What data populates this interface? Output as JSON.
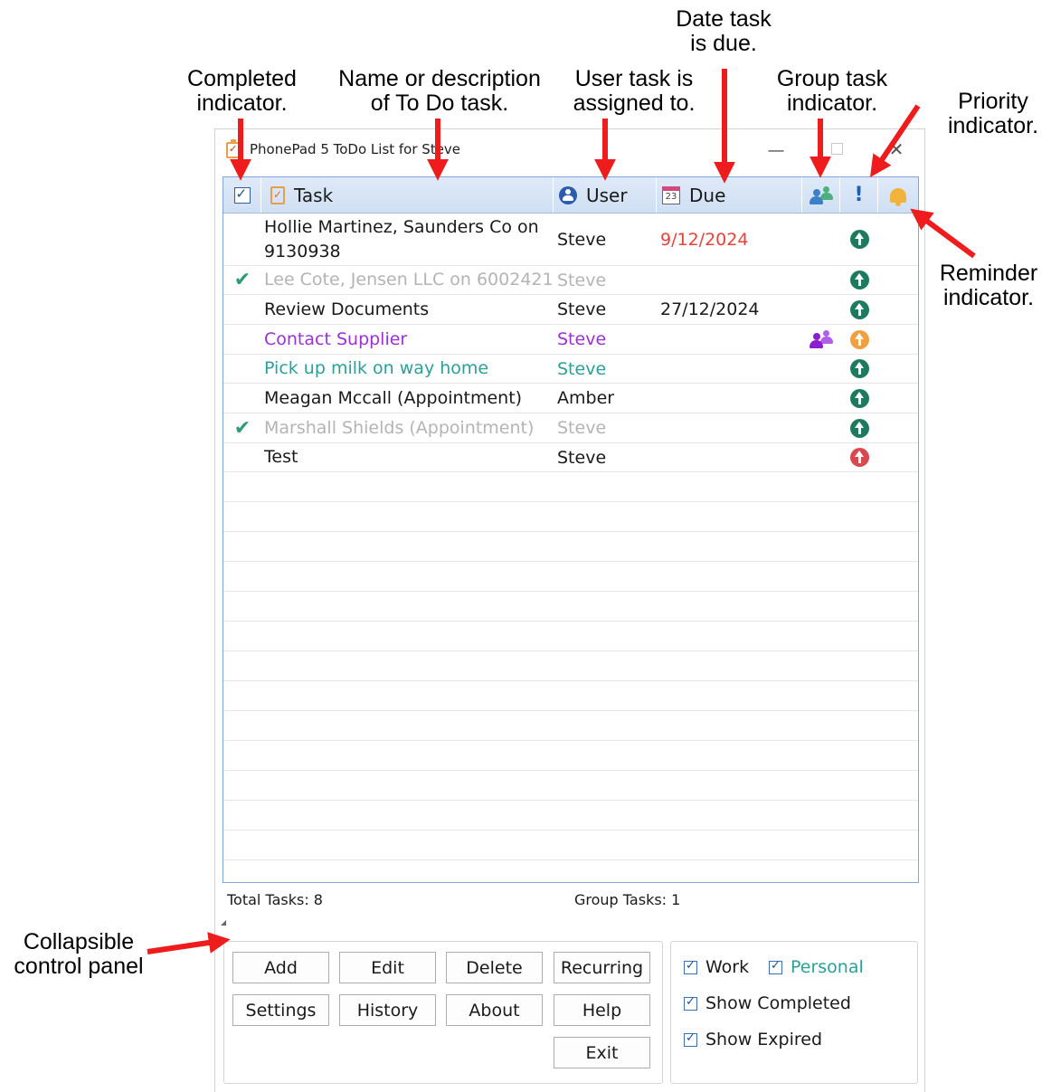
{
  "annotations": {
    "completed": [
      "Completed",
      "indicator."
    ],
    "task_name": [
      "Name or description",
      "of To Do task."
    ],
    "user": [
      "User task is",
      "assigned to."
    ],
    "due": [
      "Date task",
      "is due."
    ],
    "group": [
      "Group task",
      "indicator."
    ],
    "priority": [
      "Priority",
      "indicator."
    ],
    "reminder": [
      "Reminder",
      "indicator."
    ],
    "collapsible": [
      "Collapsible",
      "control panel"
    ]
  },
  "window": {
    "title": "PhonePad 5 ToDo List for Steve",
    "minimize_glyph": "—",
    "close_glyph": "✕"
  },
  "columns": {
    "task": "Task",
    "user": "User",
    "due": "Due",
    "due_icon_day": "23",
    "priority_glyph": "!"
  },
  "colors": {
    "normal": "#1a1a1a",
    "completed": "#b4b4b4",
    "overdue": "#e8413b",
    "work_purple": "#9b30d8",
    "personal_teal": "#2aa198",
    "priority_normal": "#1e7a5e",
    "priority_medium": "#f0a040",
    "priority_high": "#d9484e",
    "group_header_icon": "#3f7ec9",
    "arrow_red": "#ee1c1c"
  },
  "tasks": [
    {
      "done": false,
      "task": "Hollie Martinez, Saunders Co on 9130938",
      "user": "Steve",
      "due": "9/12/2024",
      "group": false,
      "priority": "normal",
      "style": "normal",
      "due_style": "overdue"
    },
    {
      "done": true,
      "task": "Lee Cote, Jensen LLC on 6002421",
      "user": "Steve",
      "due": "",
      "group": false,
      "priority": "normal",
      "style": "completed",
      "due_style": "normal"
    },
    {
      "done": false,
      "task": "Review Documents",
      "user": "Steve",
      "due": "27/12/2024",
      "group": false,
      "priority": "normal",
      "style": "normal",
      "due_style": "normal"
    },
    {
      "done": false,
      "task": "Contact Supplier",
      "user": "Steve",
      "due": "",
      "group": true,
      "priority": "medium",
      "style": "work",
      "due_style": "normal"
    },
    {
      "done": false,
      "task": "Pick up milk on way home",
      "user": "Steve",
      "due": "",
      "group": false,
      "priority": "normal",
      "style": "personal",
      "due_style": "normal"
    },
    {
      "done": false,
      "task": "Meagan Mccall (Appointment)",
      "user": "Amber",
      "due": "",
      "group": false,
      "priority": "normal",
      "style": "normal",
      "due_style": "normal"
    },
    {
      "done": true,
      "task": "Marshall Shields (Appointment)",
      "user": "Steve",
      "due": "",
      "group": false,
      "priority": "normal",
      "style": "completed",
      "due_style": "normal"
    },
    {
      "done": false,
      "task": "Test",
      "user": "Steve",
      "due": "",
      "group": false,
      "priority": "high",
      "style": "normal",
      "due_style": "normal"
    }
  ],
  "status": {
    "total": "Total Tasks: 8",
    "group": "Group Tasks: 1"
  },
  "buttons": {
    "add": "Add",
    "edit": "Edit",
    "delete": "Delete",
    "recurring": "Recurring",
    "settings": "Settings",
    "history": "History",
    "about": "About",
    "help": "Help",
    "exit": "Exit"
  },
  "options": {
    "work": {
      "label": "Work",
      "checked": true
    },
    "personal": {
      "label": "Personal",
      "checked": true
    },
    "show_completed": {
      "label": "Show Completed",
      "checked": true
    },
    "show_expired": {
      "label": "Show Expired",
      "checked": true
    }
  }
}
